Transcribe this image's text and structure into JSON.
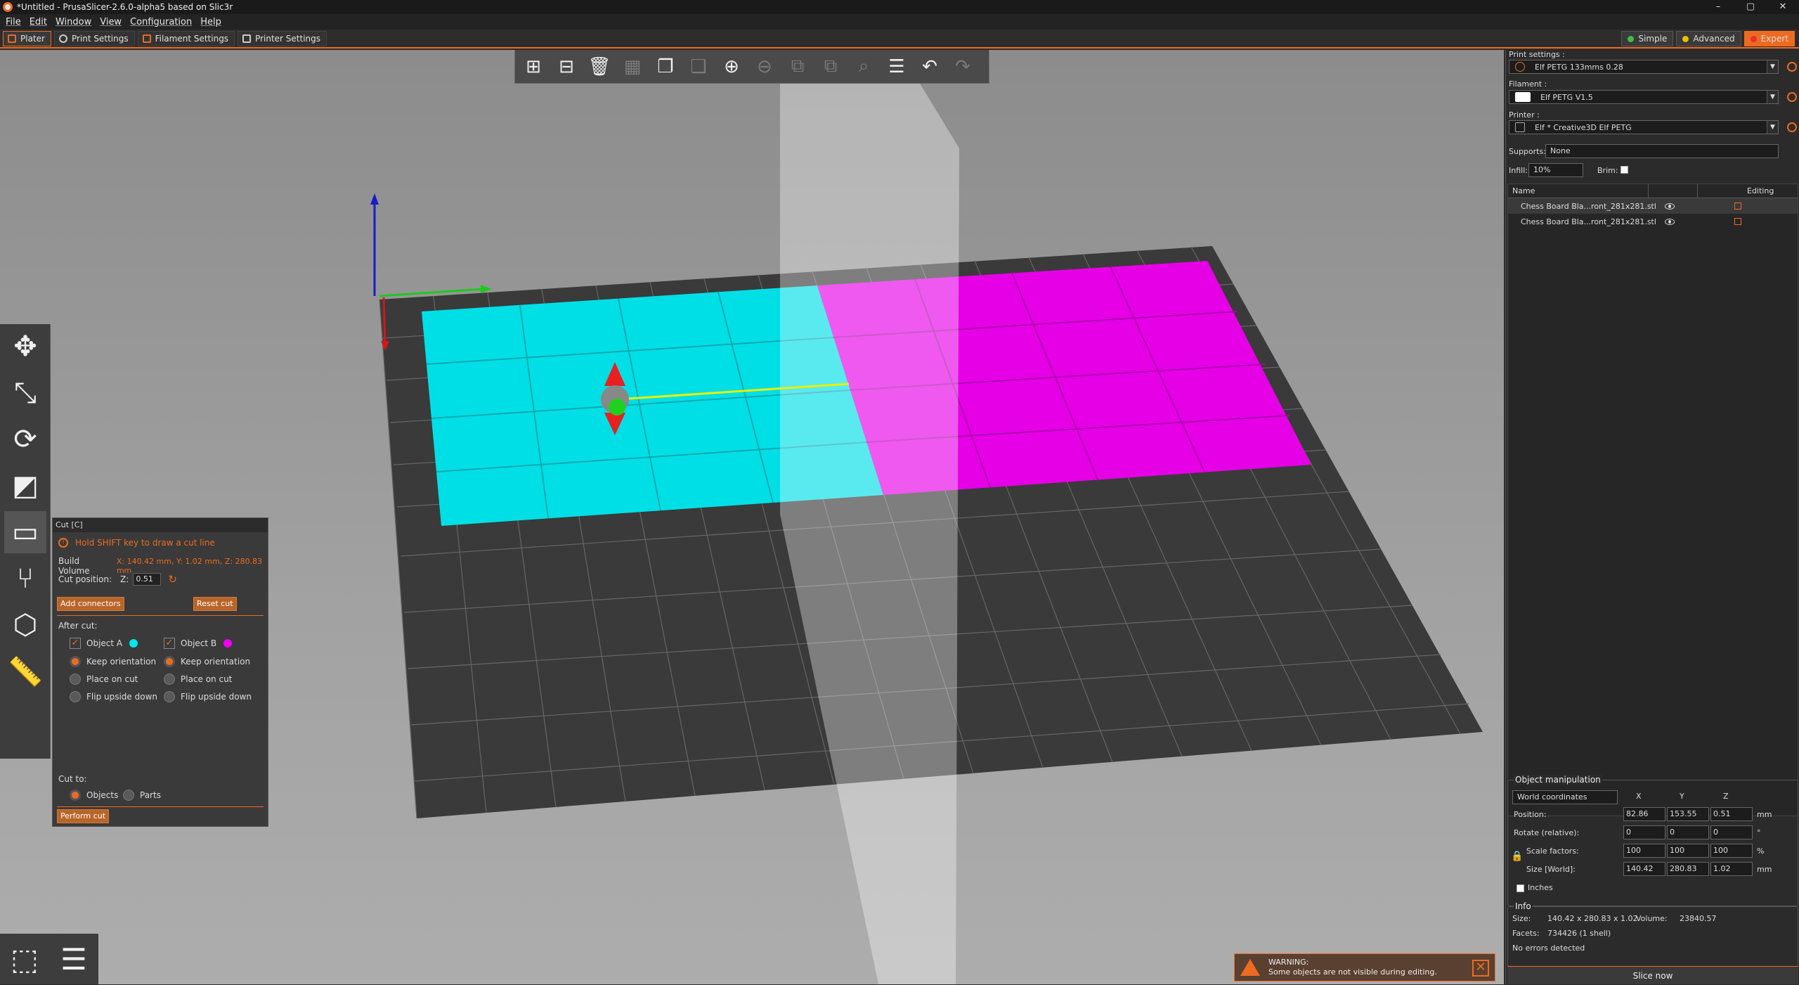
{
  "window": {
    "title": "*Untitled - PrusaSlicer-2.6.0-alpha5 based on Slic3r",
    "min": "–",
    "max": "▢",
    "close": "✕"
  },
  "menu": [
    "File",
    "Edit",
    "Window",
    "View",
    "Configuration",
    "Help"
  ],
  "tabs": [
    "Plater",
    "Print Settings",
    "Filament Settings",
    "Printer Settings"
  ],
  "modes": [
    {
      "label": "Simple",
      "color": "#3fbf3f"
    },
    {
      "label": "Advanced",
      "color": "#e8c000"
    },
    {
      "label": "Expert",
      "color": "#e83030"
    }
  ],
  "toolbar": {
    "icons": [
      "add-icon",
      "delete-icon",
      "delete-all-icon",
      "arrange-icon",
      "copy-icon",
      "paste-icon",
      "add-instance-icon",
      "remove-instance-icon",
      "split-objects-icon",
      "split-parts-icon",
      "search-icon",
      "layers-editing-icon",
      "undo-icon",
      "redo-icon"
    ]
  },
  "cut_panel": {
    "title": "Cut [C]",
    "hint": "Hold SHIFT key to draw a cut line",
    "build_volume_label": "Build Volume",
    "build_volume_value": "X: 140.42 mm,  Y: 1.02 mm,  Z: 280.83 mm",
    "cut_position_label": "Cut position:",
    "z_label": "Z:",
    "z_value": "0.51",
    "add_connectors": "Add connectors",
    "reset_cut": "Reset cut",
    "after_cut": "After cut:",
    "object_a": {
      "label": "Object A",
      "color": "#00e5ee",
      "checked": true
    },
    "object_b": {
      "label": "Object B",
      "color": "#ee00ee",
      "checked": true
    },
    "options": [
      "Keep orientation",
      "Place on cut",
      "Flip upside down"
    ],
    "cut_to": "Cut to:",
    "cut_to_options": [
      "Objects",
      "Parts"
    ],
    "perform_cut": "Perform cut"
  },
  "right_panel": {
    "print_settings_label": "Print settings :",
    "print_settings_value": "Elf PETG 133mms 0.28",
    "filament_label": "Filament :",
    "filament_value": "Elf PETG V1.5",
    "printer_label": "Printer :",
    "printer_value": "Elf * Creative3D Elf PETG",
    "supports_label": "Supports:",
    "supports_value": "None",
    "infill_label": "Infill:",
    "infill_value": "10%",
    "brim_label": "Brim:",
    "brim_checked": false,
    "objects_headers": [
      "Name",
      "Editing"
    ],
    "objects": [
      {
        "name": "Chess Board Bla...ront_281x281.stl"
      },
      {
        "name": "Chess Board Bla...ront_281x281.stl"
      }
    ]
  },
  "manipulation": {
    "title": "Object manipulation",
    "coord_system": "World coordinates",
    "axes": [
      "X",
      "Y",
      "Z"
    ],
    "position_label": "Position:",
    "position": [
      "82.86",
      "153.55",
      "0.51"
    ],
    "position_unit": "mm",
    "rotate_label": "Rotate (relative):",
    "rotate": [
      "0",
      "0",
      "0"
    ],
    "rotate_unit": "°",
    "scale_label": "Scale factors:",
    "scale": [
      "100",
      "100",
      "100"
    ],
    "scale_unit": "%",
    "size_label": "Size [World]:",
    "size": [
      "140.42",
      "280.83",
      "1.02"
    ],
    "size_unit": "mm",
    "inches_label": "Inches"
  },
  "info": {
    "title": "Info",
    "size_label": "Size:",
    "size_value": "140.42 x 280.83 x 1.02",
    "volume_label": "Volume:",
    "volume_value": "23840.57",
    "facets_label": "Facets:",
    "facets_value": "734426 (1 shell)",
    "errors": "No errors detected"
  },
  "slice_button": "Slice now",
  "warning": {
    "title": "WARNING:",
    "text": "Some objects are not visible during editing."
  },
  "colors": {
    "accent": "#ed6b21",
    "object_a": "#00e5ee",
    "object_b": "#ee00ee"
  }
}
